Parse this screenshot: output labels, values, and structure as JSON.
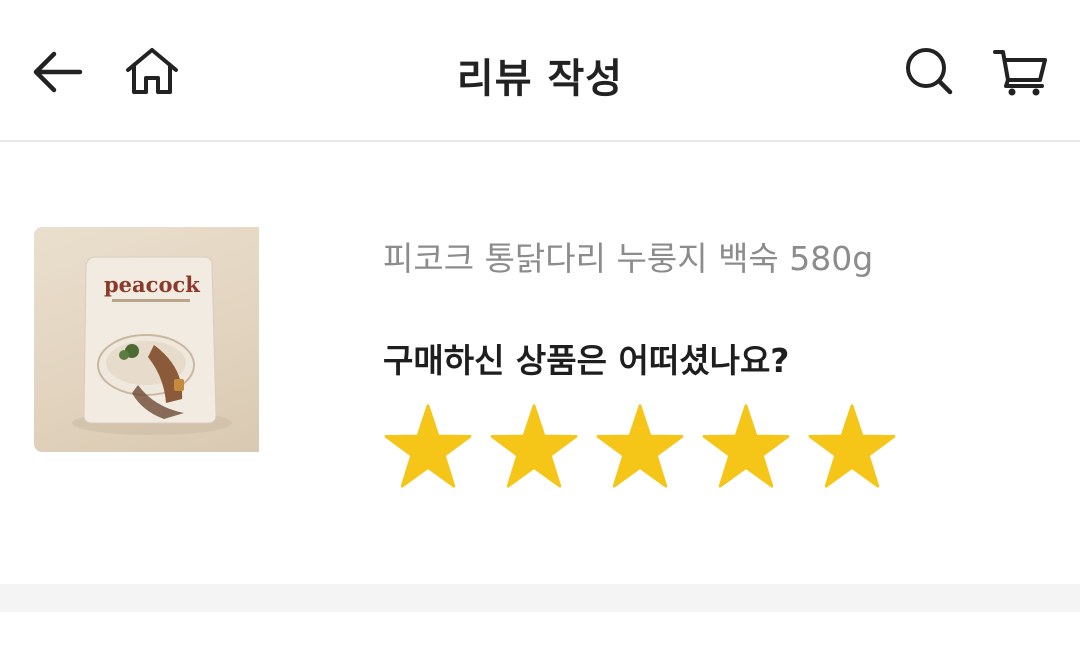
{
  "header": {
    "title": "리뷰 작성",
    "icons": [
      "back-arrow-icon",
      "home-icon",
      "search-icon",
      "cart-icon"
    ]
  },
  "product": {
    "name": "피코크 통닭다리 누룽지 백숙 580g",
    "image_label": "peacock"
  },
  "rating": {
    "question": "구매하신 상품은 어떠셨나요?",
    "value": 5,
    "max": 5,
    "star_color": "#F5C518"
  },
  "colors": {
    "product_name": "#8c8c8c",
    "divider_band": "#f4f4f4"
  }
}
